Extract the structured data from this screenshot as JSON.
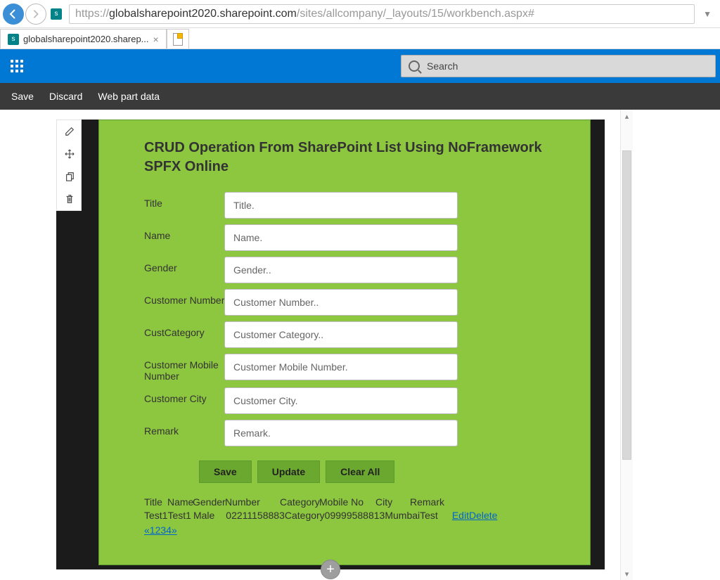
{
  "browser": {
    "url_host": "globalsharepoint2020.sharepoint.com",
    "url_path": "/sites/allcompany/_layouts/15/workbench.aspx#",
    "tab_title": "globalsharepoint2020.sharep..."
  },
  "sp_header": {
    "search_placeholder": "Search"
  },
  "workbench_toolbar": {
    "save": "Save",
    "discard": "Discard",
    "webpartdata": "Web part data"
  },
  "panel": {
    "title": "CRUD Operation From SharePoint List Using NoFramework SPFX Online",
    "fields": {
      "title": {
        "label": "Title",
        "placeholder": "Title."
      },
      "name": {
        "label": "Name",
        "placeholder": "Name."
      },
      "gender": {
        "label": "Gender",
        "placeholder": "Gender.."
      },
      "custno": {
        "label": "Customer Number",
        "placeholder": "Customer Number.."
      },
      "custcat": {
        "label": "CustCategory",
        "placeholder": "Customer Category.."
      },
      "mobile": {
        "label": "Customer Mobile Number",
        "placeholder": "Customer Mobile Number."
      },
      "city": {
        "label": "Customer City",
        "placeholder": "Customer City."
      },
      "remark": {
        "label": "Remark",
        "placeholder": "Remark."
      }
    },
    "buttons": {
      "save": "Save",
      "update": "Update",
      "clear": "Clear All"
    },
    "table": {
      "headers": {
        "title": "Title",
        "name": "Name",
        "gender": "Gender",
        "number": "Number",
        "category": "Category",
        "mobile": "Mobile No",
        "city": "City",
        "remark": "Remark"
      },
      "row": {
        "title": "Test1",
        "name": "Test1",
        "gender": "Male",
        "number": "02211158883",
        "category": "Category0",
        "mobile": "9999588813",
        "city": "Mumbai",
        "remark": "Test",
        "edit": "Edit",
        "delete": "Delete"
      },
      "pager": "«1234»"
    }
  }
}
